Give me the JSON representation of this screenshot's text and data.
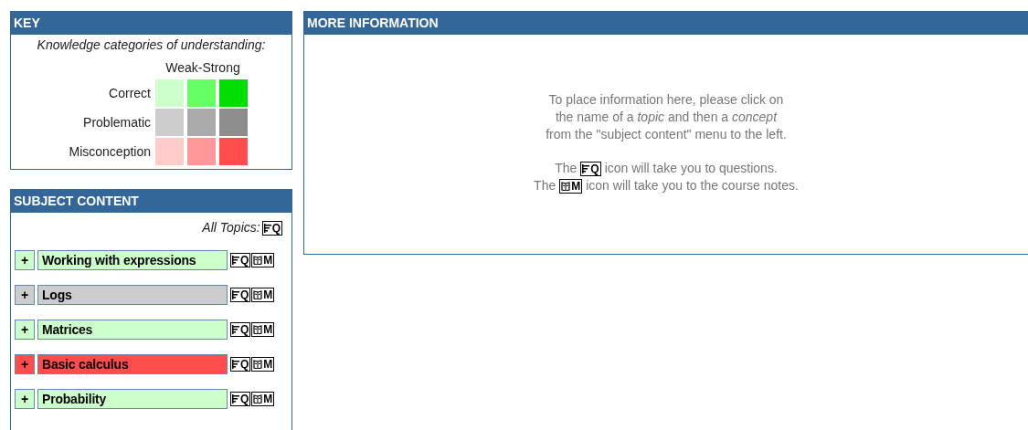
{
  "key": {
    "title": "KEY",
    "caption": "Knowledge categories of understanding:",
    "scale_label": "Weak-Strong",
    "categories": [
      {
        "label": "Correct",
        "swatches": [
          {
            "color": "#ccffcc"
          },
          {
            "color": "#66ff66"
          },
          {
            "color": "#00dd00"
          }
        ]
      },
      {
        "label": "Problematic",
        "swatches": [
          {
            "color": "#cccccc"
          },
          {
            "color": "#aaaaaa"
          },
          {
            "color": "#8c8c8c"
          }
        ]
      },
      {
        "label": "Misconception",
        "swatches": [
          {
            "color": "#ffcccc"
          },
          {
            "color": "#ff9999"
          },
          {
            "color": "#ff4c4c"
          }
        ]
      }
    ]
  },
  "subject_content": {
    "title": "SUBJECT CONTENT",
    "all_topics": {
      "label": "All Topics:",
      "question_letter": "Q"
    },
    "topics": [
      {
        "expander": "+",
        "name": "Working with expressions",
        "color": "#ccffcc",
        "question_letter": "Q",
        "notes_letter": "M"
      },
      {
        "expander": "+",
        "name": "Logs",
        "color": "#cccccc",
        "question_letter": "Q",
        "notes_letter": "M"
      },
      {
        "expander": "+",
        "name": "Matrices",
        "color": "#ccffcc",
        "question_letter": "Q",
        "notes_letter": "M"
      },
      {
        "expander": "+",
        "name": "Basic calculus",
        "color": "#ff4c4c",
        "question_letter": "Q",
        "notes_letter": "M"
      },
      {
        "expander": "+",
        "name": "Probability",
        "color": "#ccffcc",
        "question_letter": "Q",
        "notes_letter": "M"
      }
    ]
  },
  "more_information": {
    "title": "MORE INFORMATION",
    "intro_lines": [
      "To place information here, please click on",
      "the name of a *topic* and then a *concept*",
      "from the \"subject content\" menu to the left."
    ],
    "icon_lines": [
      {
        "kind": "questions",
        "before": "The",
        "letter": "Q",
        "after": "icon will take you to questions."
      },
      {
        "kind": "notes",
        "before": "The",
        "letter": "M",
        "after": "icon will take you to the course notes."
      }
    ]
  }
}
